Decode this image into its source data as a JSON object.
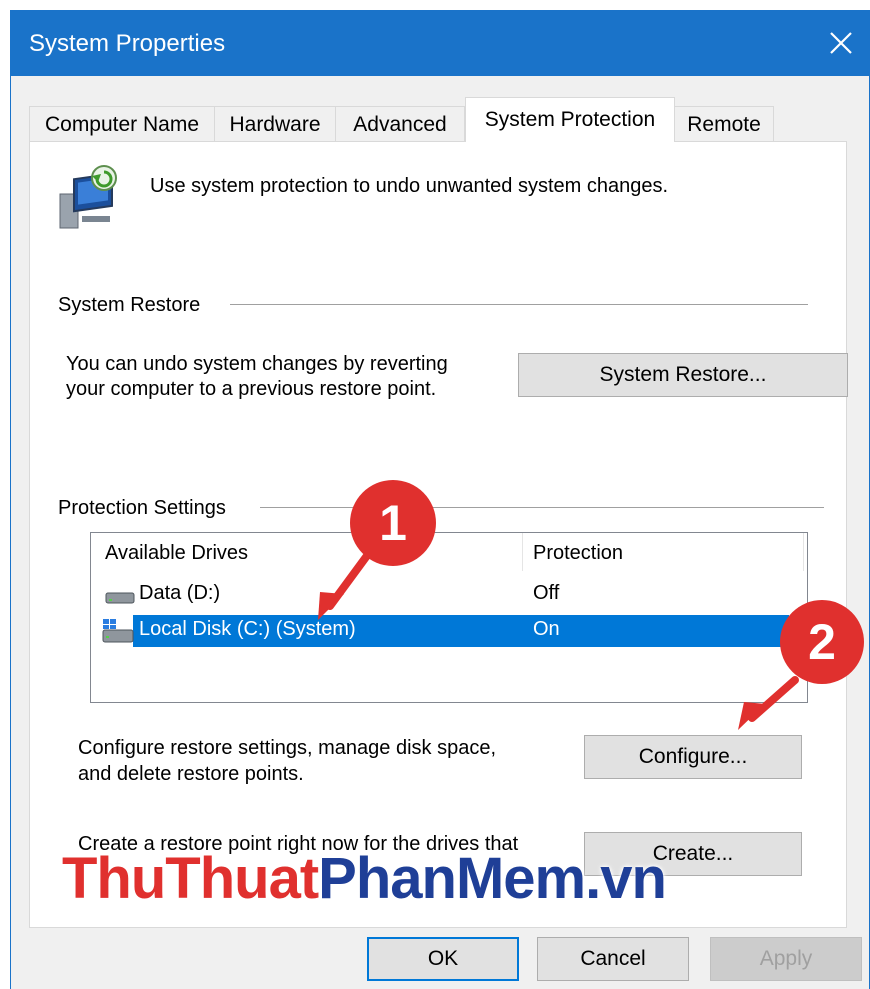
{
  "window": {
    "title": "System Properties"
  },
  "tabs": [
    "Computer Name",
    "Hardware",
    "Advanced",
    "System Protection",
    "Remote"
  ],
  "intro_text": "Use system protection to undo unwanted system changes.",
  "system_restore": {
    "group_label": "System Restore",
    "description_line1": "You can undo system changes by reverting",
    "description_line2": "your computer to a previous restore point.",
    "button": "System Restore..."
  },
  "protection": {
    "group_label": "Protection Settings",
    "columns": [
      "Available Drives",
      "Protection"
    ],
    "drives": [
      {
        "name": "Data (D:)",
        "protection": "Off",
        "selected": false
      },
      {
        "name": "Local Disk (C:) (System)",
        "protection": "On",
        "selected": true
      }
    ],
    "configure_line1": "Configure restore settings, manage disk space,",
    "configure_line2": "and delete restore points.",
    "configure_button": "Configure...",
    "create_line1": "Create a restore point right now for the drives that",
    "create_button": "Create..."
  },
  "footer": {
    "ok": "OK",
    "cancel": "Cancel",
    "apply": "Apply"
  },
  "annotations": {
    "step1": "1",
    "step2": "2",
    "accent": "#e0302e"
  },
  "watermark": {
    "part1": "ThuThuat",
    "part2": "PhanMem",
    "part3": ".vn"
  }
}
